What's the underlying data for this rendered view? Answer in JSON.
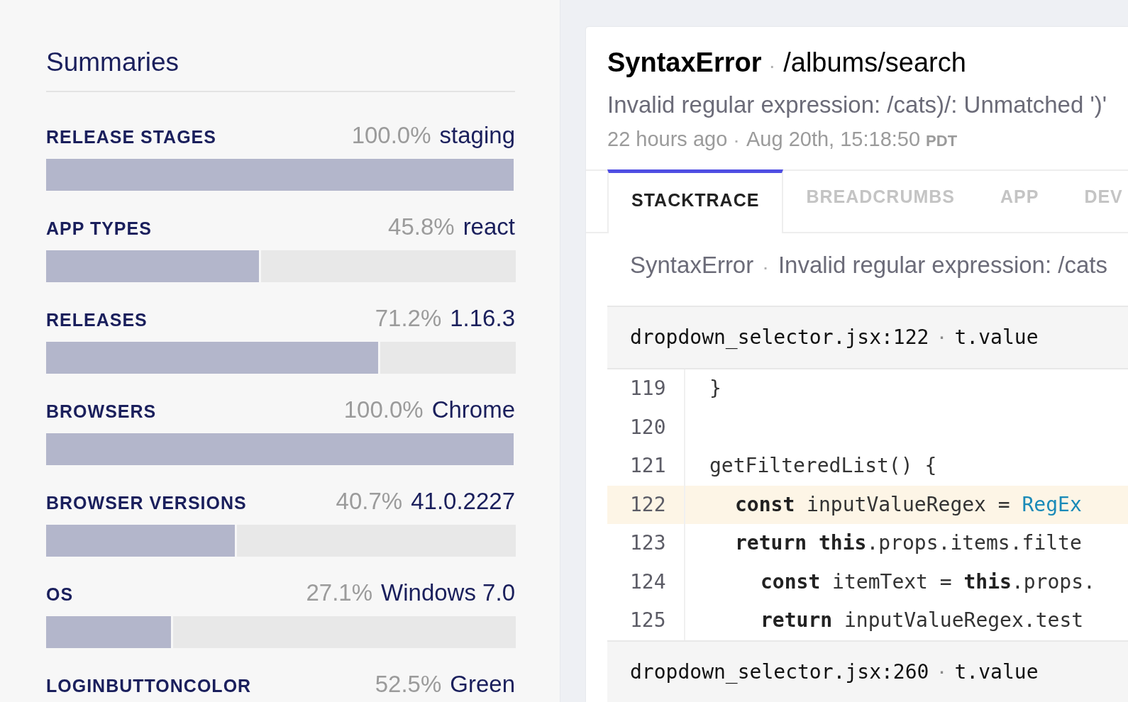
{
  "summaries": {
    "title": "Summaries",
    "items": [
      {
        "label": "RELEASE STAGES",
        "percent": "100.0%",
        "value": "staging",
        "level": 1.0
      },
      {
        "label": "APP TYPES",
        "percent": "45.8%",
        "value": "react",
        "level": 0.458
      },
      {
        "label": "RELEASES",
        "percent": "71.2%",
        "value": "1.16.3",
        "level": 0.712
      },
      {
        "label": "BROWSERS",
        "percent": "100.0%",
        "value": "Chrome",
        "level": 1.0
      },
      {
        "label": "BROWSER VERSIONS",
        "percent": "40.7%",
        "value": "41.0.2227",
        "level": 0.407
      },
      {
        "label": "OS",
        "percent": "27.1%",
        "value": "Windows 7.0",
        "level": 0.271
      },
      {
        "label": "LOGINBUTTONCOLOR",
        "percent": "52.5%",
        "value": "Green"
      }
    ]
  },
  "error": {
    "class": "SyntaxError",
    "separator": "·",
    "context": "/albums/search",
    "message": "Invalid regular expression: /cats)/: Unmatched ')'",
    "relative_time": "22 hours ago",
    "time_separator": "·",
    "timestamp": "Aug 20th, 15:18:50",
    "timezone": "PDT",
    "tabs": [
      {
        "label": "STACKTRACE",
        "selected": true
      },
      {
        "label": "BREADCRUMBS",
        "selected": false
      },
      {
        "label": "APP",
        "selected": false
      },
      {
        "label": "DEV",
        "selected": false
      }
    ],
    "exception": {
      "class": "SyntaxError",
      "separator": "·",
      "message": "Invalid regular expression: /cats"
    },
    "frames": [
      {
        "file": "dropdown_selector.jsx:122",
        "separator": "·",
        "method": "t.value",
        "lines": [
          {
            "number": "119",
            "highlighted": false,
            "kind": "top",
            "tokens": [
              {
                "kind": "plain",
                "text": "}"
              }
            ]
          },
          {
            "number": "120",
            "highlighted": false
          },
          {
            "number": "121",
            "highlighted": false,
            "kind": "top",
            "tokens": [
              {
                "kind": "plain",
                "text": "getFilteredList() {"
              }
            ]
          },
          {
            "number": "122",
            "highlighted": true,
            "kind": "nested",
            "tokens": [
              {
                "kind": "keyword",
                "text": "const"
              },
              {
                "kind": "plain",
                "text": "inputValueRegex ="
              },
              {
                "kind": "builtin",
                "text": "RegEx"
              }
            ]
          },
          {
            "number": "123",
            "highlighted": false,
            "kind": "nested",
            "tokens": [
              {
                "kind": "keyword",
                "text": "return"
              },
              {
                "kind": "keyword",
                "text": "this"
              },
              {
                "kind": "plain",
                "text": ".props.items.filte"
              }
            ]
          },
          {
            "number": "124",
            "highlighted": false,
            "kind": "deep",
            "tokens": [
              {
                "kind": "keyword",
                "text": "const"
              },
              {
                "kind": "plain",
                "text": "itemText ="
              },
              {
                "kind": "keyword",
                "text": "this"
              },
              {
                "kind": "plain",
                "text": ".props."
              }
            ]
          },
          {
            "number": "125",
            "highlighted": false,
            "kind": "deep",
            "tokens": [
              {
                "kind": "keyword",
                "text": "return"
              },
              {
                "kind": "plain",
                "text": "inputValueRegex.test"
              }
            ]
          }
        ]
      },
      {
        "file": "dropdown_selector.jsx:260",
        "separator": "·",
        "method": "t.value"
      }
    ]
  }
}
